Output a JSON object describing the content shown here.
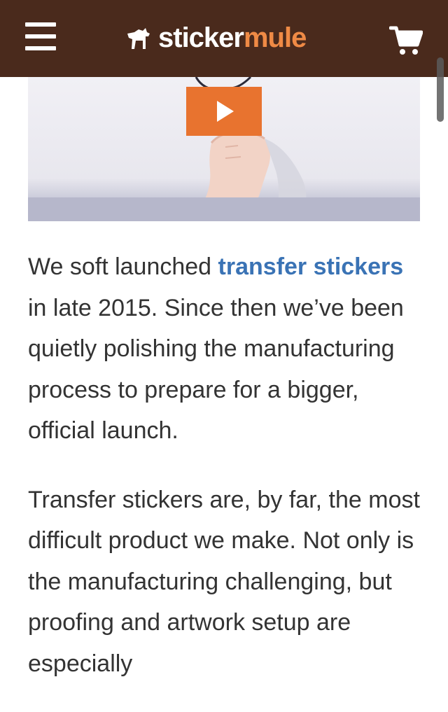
{
  "header": {
    "menu_icon": "hamburger-menu-icon",
    "logo_part1": "sticker",
    "logo_part2": "mule",
    "cart_icon": "shopping-cart-icon",
    "colors": {
      "bar": "#4a2a1c",
      "logo_accent": "#ef8a45"
    }
  },
  "video": {
    "play_icon": "play-icon",
    "play_color": "#e8732f"
  },
  "article": {
    "p1_before": "We soft launched ",
    "p1_link": "transfer stickers",
    "p1_after": " in late 2015. Since then we’ve been quietly polishing the manufacturing process to prepare for a bigger, official launch.",
    "p2": "Transfer stickers are, by far, the most difficult product we make. Not only is the manufacturing challenging, but proofing and artwork setup are especially",
    "link_color": "#3a73b5"
  }
}
